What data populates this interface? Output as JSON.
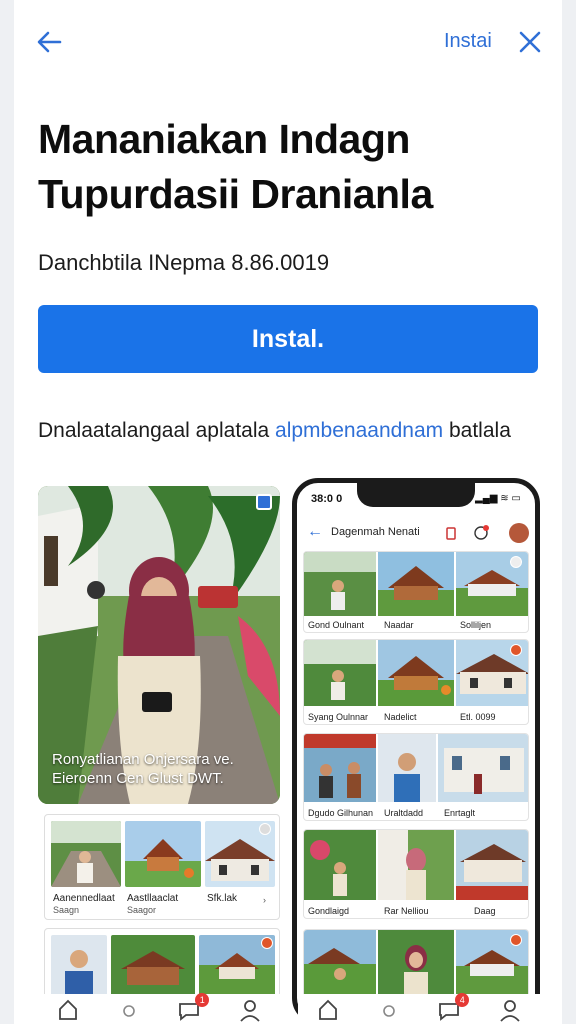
{
  "header": {
    "install_link": "Instai"
  },
  "app": {
    "title_line1": "Mananiakan Indagn",
    "title_line2": "Tupurdasii Dranianla",
    "subtitle": "Danchbtila INepma 8.86.0019",
    "install_button": "Instal.",
    "description_prefix": "Dnalaatalangaal aplatala ",
    "description_link": "alpmbenaandnam",
    "description_suffix": " batlala"
  },
  "preview": {
    "hero_caption_line1": "Ronyatlianan Onjersara ve.",
    "hero_caption_line2": "Eieroenn Cen Glust DWT.",
    "grid1": [
      {
        "label": "Aanennedlaat",
        "sub": "Saagn"
      },
      {
        "label": "Aastllaaclat",
        "sub": "Saagor"
      },
      {
        "label": "Sfk.lak",
        "sub": ""
      }
    ]
  },
  "phone": {
    "time": "38:0 0",
    "status": "▂▄▆ ≋ ▭",
    "title": "Dagenmah Nenati",
    "rows": [
      [
        "Gond Oulnant",
        "Naadar",
        "Solliljen"
      ],
      [
        "Syang Oulnnar",
        "Nadelict",
        "Etl. 0099"
      ],
      [
        "Dgudo Gilhunan",
        "Uraltdadd",
        "Enrtaglt"
      ],
      [
        "Gondlaigd",
        "Rar Nelliou",
        "Daag"
      ]
    ]
  },
  "nav": {
    "badge_left": "1",
    "badge_right": "4"
  },
  "colors": {
    "accent": "#1a73e8",
    "link": "#2f6fd6"
  }
}
